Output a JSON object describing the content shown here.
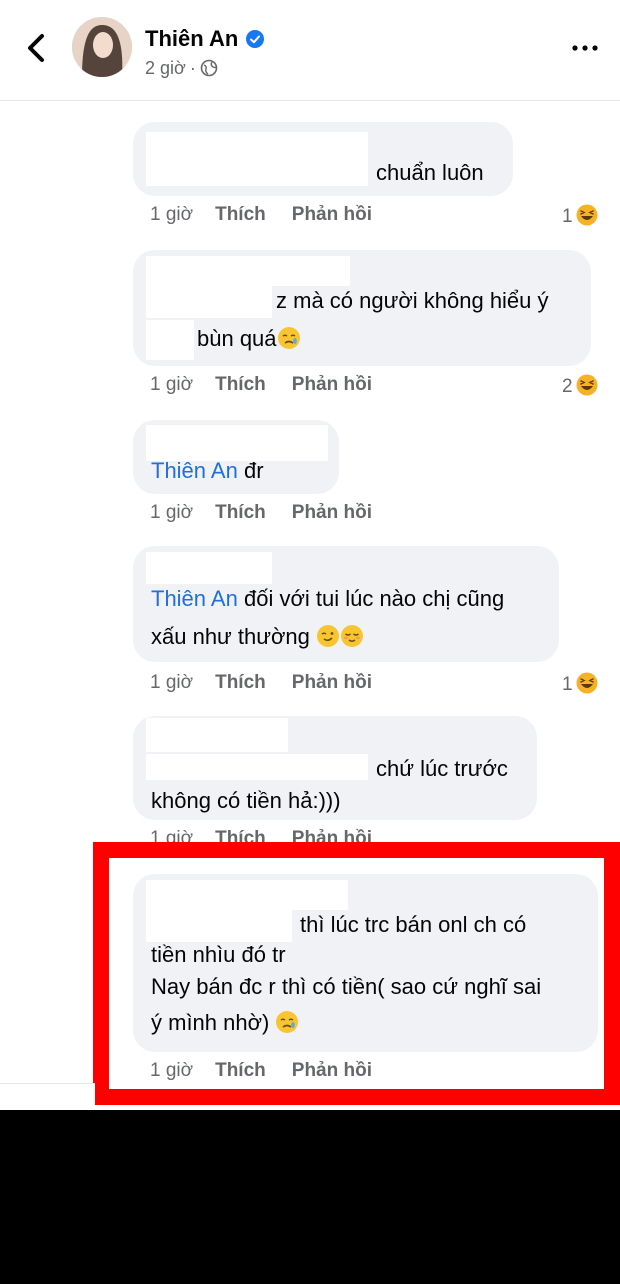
{
  "header": {
    "name": "Thiên An",
    "time": "2 giờ",
    "dot": "·"
  },
  "comments": [
    {
      "text": "chuẩn luôn",
      "time": "1 giờ",
      "like": "Thích",
      "reply": "Phản hồi",
      "reaction_count": "1"
    },
    {
      "line1": "z mà có người không hiểu ý",
      "line2": "bùn quá",
      "time": "1 giờ",
      "like": "Thích",
      "reply": "Phản hồi",
      "reaction_count": "2"
    },
    {
      "mention": "Thiên An",
      "text": "đr",
      "time": "1 giờ",
      "like": "Thích",
      "reply": "Phản hồi"
    },
    {
      "mention": "Thiên An",
      "line1": "đối với tui lúc nào chị cũng",
      "line2": "xấu như thường",
      "time": "1 giờ",
      "like": "Thích",
      "reply": "Phản hồi",
      "reaction_count": "1"
    },
    {
      "line1": "chứ lúc trước",
      "line2": "không có tiền hả:)))",
      "time": "1 giờ",
      "like": "Thích",
      "reply": "Phản hồi"
    },
    {
      "line1": "thì lúc trc bán onl ch có",
      "line2": "tiền  nhìu đó tr",
      "line3": "Nay bán đc r thì có tiền( sao cứ nghĩ sai",
      "line4": "ý mình nhờ)",
      "time": "1 giờ",
      "like": "Thích",
      "reply": "Phản hồi"
    }
  ],
  "colors": {
    "highlight": "#ff0000",
    "bubble": "#f0f2f5",
    "mention": "#216fdb",
    "verified": "#1877f2"
  }
}
